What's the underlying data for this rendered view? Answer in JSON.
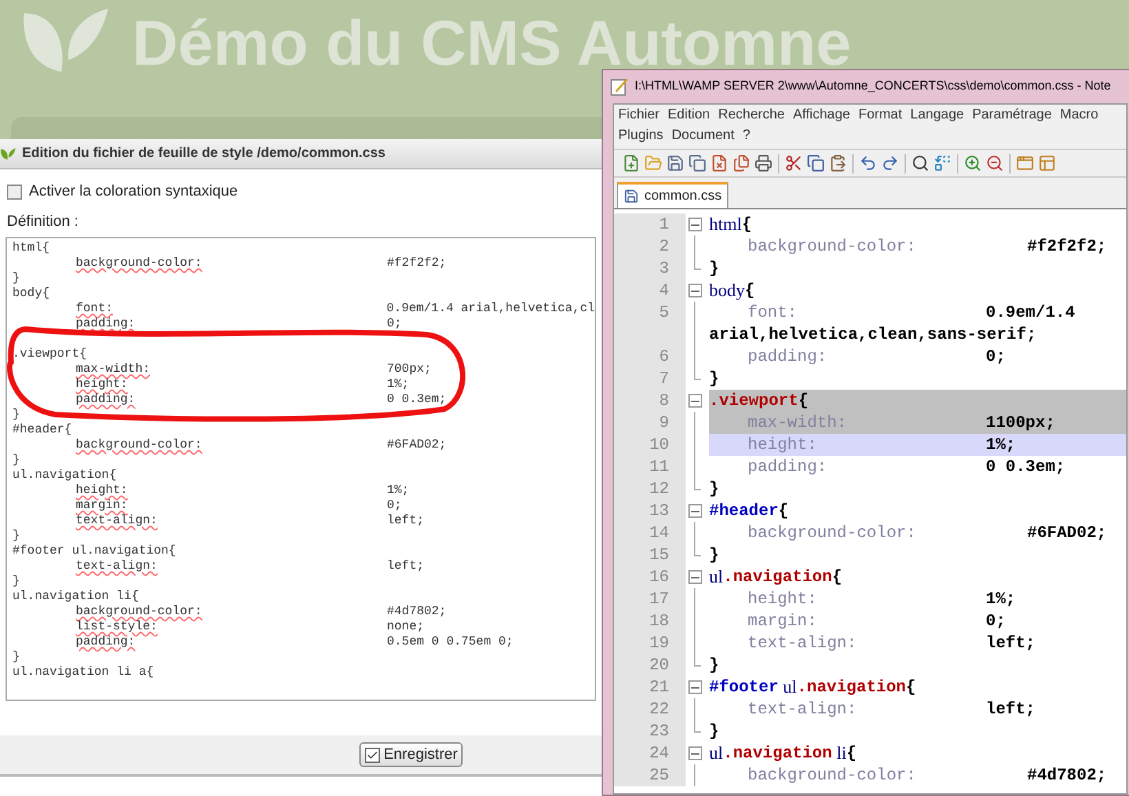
{
  "site": {
    "title": "Démo du CMS Automne"
  },
  "dialog": {
    "title": "Edition du fichier de feuille de style /demo/common.css",
    "syntax_checkbox": {
      "label": "Activer la coloration syntaxique",
      "checked": false
    },
    "definition_label": "Définition :",
    "code_lines": [
      {
        "kind": "selector",
        "text": "html{"
      },
      {
        "kind": "decl",
        "prop": "background-color:",
        "value": "#f2f2f2;"
      },
      {
        "kind": "close",
        "text": "}"
      },
      {
        "kind": "selector",
        "text": "body{"
      },
      {
        "kind": "decl",
        "prop": "font:",
        "value": "0.9em/1.4 arial,helvetica,cl"
      },
      {
        "kind": "decl",
        "prop": "padding:",
        "value": "0;"
      },
      {
        "kind": "blank"
      },
      {
        "kind": "selector",
        "text": ".viewport{"
      },
      {
        "kind": "decl",
        "prop": "max-width:",
        "value": "700px;"
      },
      {
        "kind": "decl",
        "prop": "height:",
        "value": "1%;"
      },
      {
        "kind": "decl",
        "prop": "padding:",
        "value": "0 0.3em;"
      },
      {
        "kind": "close",
        "text": "}"
      },
      {
        "kind": "selector",
        "text": "#header{"
      },
      {
        "kind": "decl",
        "prop": "background-color:",
        "value": "#6FAD02;"
      },
      {
        "kind": "close",
        "text": "}"
      },
      {
        "kind": "selector",
        "text": "ul.navigation{"
      },
      {
        "kind": "decl",
        "prop": "height:",
        "value": "1%;"
      },
      {
        "kind": "decl",
        "prop": "margin:",
        "value": "0;"
      },
      {
        "kind": "decl",
        "prop": "text-align:",
        "value": "left;"
      },
      {
        "kind": "close",
        "text": "}"
      },
      {
        "kind": "selector",
        "text": "#footer ul.navigation{"
      },
      {
        "kind": "decl",
        "prop": "text-align:",
        "value": "left;"
      },
      {
        "kind": "close",
        "text": "}"
      },
      {
        "kind": "selector",
        "text": "ul.navigation li{"
      },
      {
        "kind": "decl",
        "prop": "background-color:",
        "value": "#4d7802;"
      },
      {
        "kind": "decl",
        "prop": "list-style:",
        "value": "none;"
      },
      {
        "kind": "decl",
        "prop": "padding:",
        "value": "0.5em 0 0.75em 0;"
      },
      {
        "kind": "close",
        "text": "}"
      },
      {
        "kind": "selector",
        "text": "ul.navigation li a{"
      }
    ],
    "save_button": "Enregistrer"
  },
  "editor": {
    "title": "I:\\HTML\\WAMP SERVER 2\\www\\Automne_CONCERTS\\css\\demo\\common.css - Note",
    "menu_rows": [
      [
        "Fichier",
        "Edition",
        "Recherche",
        "Affichage",
        "Format",
        "Langage",
        "Paramétrage",
        "Macro"
      ],
      [
        "Plugins",
        "Document",
        "?"
      ]
    ],
    "tab": {
      "label": "common.css",
      "selected": true
    },
    "lines": [
      {
        "num": "1",
        "selected": false,
        "current": false,
        "parts": [
          {
            "kind": "tag",
            "text": "html"
          },
          {
            "kind": "punct",
            "text": "{"
          }
        ]
      },
      {
        "num": "2",
        "selected": false,
        "current": false,
        "parts": [
          {
            "kind": "prop",
            "text": "background-color:"
          },
          {
            "kind": "value",
            "text": "#f2f2f2;"
          }
        ]
      },
      {
        "num": "3",
        "selected": false,
        "current": false,
        "parts": [
          {
            "kind": "punct",
            "text": "}"
          }
        ]
      },
      {
        "num": "4",
        "selected": false,
        "current": false,
        "parts": [
          {
            "kind": "tag",
            "text": "body"
          },
          {
            "kind": "punct",
            "text": "{"
          }
        ]
      },
      {
        "num": "5",
        "selected": false,
        "current": false,
        "parts": [
          {
            "kind": "prop",
            "text": "font:"
          },
          {
            "kind": "value",
            "text": "0.9em/1.4"
          }
        ],
        "continuation": "arial,helvetica,clean,sans-serif;"
      },
      {
        "num": "6",
        "selected": false,
        "current": false,
        "parts": [
          {
            "kind": "prop",
            "text": "padding:"
          },
          {
            "kind": "value",
            "text": "0;"
          }
        ]
      },
      {
        "num": "7",
        "selected": false,
        "current": false,
        "parts": [
          {
            "kind": "punct",
            "text": "}"
          }
        ]
      },
      {
        "num": "8",
        "selected": true,
        "current": false,
        "parts": [
          {
            "kind": "class",
            "text": ".viewport"
          },
          {
            "kind": "punct",
            "text": "{"
          }
        ]
      },
      {
        "num": "9",
        "selected": true,
        "current": false,
        "parts": [
          {
            "kind": "prop",
            "text": "max-width:"
          },
          {
            "kind": "value",
            "text": "1100px;"
          }
        ]
      },
      {
        "num": "10",
        "selected": false,
        "current": true,
        "parts": [
          {
            "kind": "prop",
            "text": "height:"
          },
          {
            "kind": "value",
            "text": "1%;"
          }
        ]
      },
      {
        "num": "11",
        "selected": false,
        "current": false,
        "parts": [
          {
            "kind": "prop",
            "text": "padding:"
          },
          {
            "kind": "value",
            "text": "0 0.3em;"
          }
        ]
      },
      {
        "num": "12",
        "selected": false,
        "current": false,
        "parts": [
          {
            "kind": "punct",
            "text": "}"
          }
        ]
      },
      {
        "num": "13",
        "selected": false,
        "current": false,
        "parts": [
          {
            "kind": "id",
            "text": "#header"
          },
          {
            "kind": "punct",
            "text": "{"
          }
        ]
      },
      {
        "num": "14",
        "selected": false,
        "current": false,
        "parts": [
          {
            "kind": "prop",
            "text": "background-color:"
          },
          {
            "kind": "value",
            "text": "#6FAD02;"
          }
        ]
      },
      {
        "num": "15",
        "selected": false,
        "current": false,
        "parts": [
          {
            "kind": "punct",
            "text": "}"
          }
        ]
      },
      {
        "num": "16",
        "selected": false,
        "current": false,
        "parts": [
          {
            "kind": "tag",
            "text": "ul"
          },
          {
            "kind": "class",
            "text": ".navigation"
          },
          {
            "kind": "punct",
            "text": "{"
          }
        ]
      },
      {
        "num": "17",
        "selected": false,
        "current": false,
        "parts": [
          {
            "kind": "prop",
            "text": "height:"
          },
          {
            "kind": "value",
            "text": "1%;"
          }
        ]
      },
      {
        "num": "18",
        "selected": false,
        "current": false,
        "parts": [
          {
            "kind": "prop",
            "text": "margin:"
          },
          {
            "kind": "value",
            "text": "0;"
          }
        ]
      },
      {
        "num": "19",
        "selected": false,
        "current": false,
        "parts": [
          {
            "kind": "prop",
            "text": "text-align:"
          },
          {
            "kind": "value",
            "text": "left;"
          }
        ]
      },
      {
        "num": "20",
        "selected": false,
        "current": false,
        "parts": [
          {
            "kind": "punct",
            "text": "}"
          }
        ]
      },
      {
        "num": "21",
        "selected": false,
        "current": false,
        "parts": [
          {
            "kind": "id",
            "text": "#footer"
          },
          {
            "kind": "tag",
            "text": " ul"
          },
          {
            "kind": "class",
            "text": ".navigation"
          },
          {
            "kind": "punct",
            "text": "{"
          }
        ]
      },
      {
        "num": "22",
        "selected": false,
        "current": false,
        "parts": [
          {
            "kind": "prop",
            "text": "text-align:"
          },
          {
            "kind": "value",
            "text": "left;"
          }
        ]
      },
      {
        "num": "23",
        "selected": false,
        "current": false,
        "parts": [
          {
            "kind": "punct",
            "text": "}"
          }
        ]
      },
      {
        "num": "24",
        "selected": false,
        "current": false,
        "parts": [
          {
            "kind": "tag",
            "text": "ul"
          },
          {
            "kind": "class",
            "text": ".navigation"
          },
          {
            "kind": "tag",
            "text": " li"
          },
          {
            "kind": "punct",
            "text": "{"
          }
        ]
      },
      {
        "num": "25",
        "selected": false,
        "current": false,
        "parts": [
          {
            "kind": "prop",
            "text": "background-color:"
          },
          {
            "kind": "value",
            "text": "#4d7802;"
          }
        ]
      }
    ]
  }
}
